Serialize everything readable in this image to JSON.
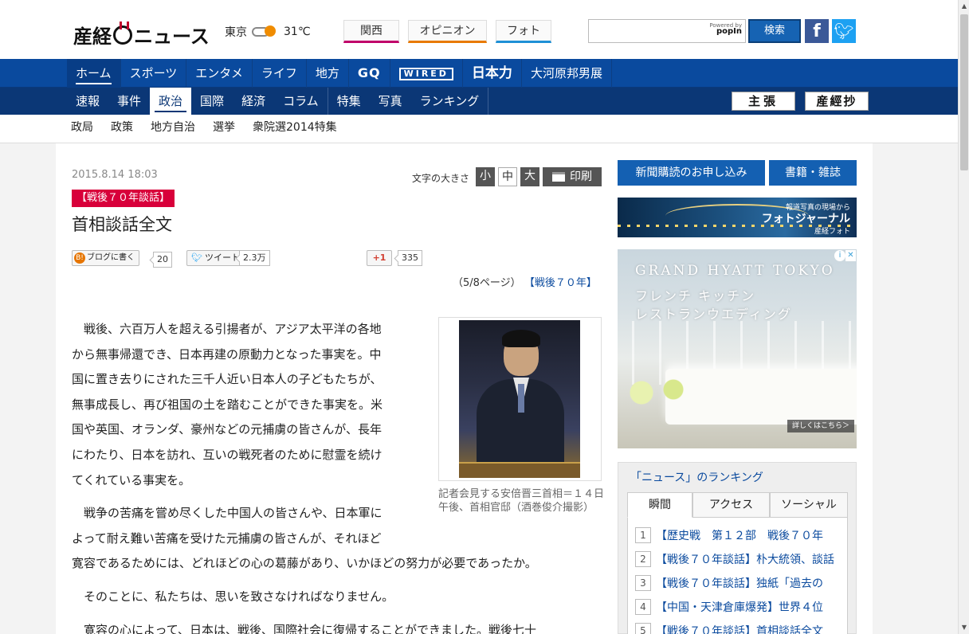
{
  "header": {
    "logo_left": "産経",
    "logo_right": "ニュース",
    "weather_city": "東京",
    "weather_icon": "sun-cloud-icon",
    "weather_temp": "31℃",
    "tabs": [
      "関西",
      "オピニオン",
      "フォト"
    ],
    "search_placeholder": "",
    "powered_by_small": "Powered by",
    "powered_by_brand": "popIn",
    "search_button": "検索",
    "facebook": "f",
    "twitter": "t"
  },
  "nav_main": [
    "ホーム",
    "スポーツ",
    "エンタメ",
    "ライフ",
    "地方",
    "GQ",
    "WIRED",
    "日本力",
    "大河原邦男展"
  ],
  "nav_sections": [
    "速報",
    "事件",
    "政治",
    "国際",
    "経済",
    "コラム",
    "特集",
    "写真",
    "ランキング"
  ],
  "nav_badges": {
    "shucho": "主張",
    "sankeisho": "産經抄"
  },
  "subnav": [
    "政局",
    "政策",
    "地方自治",
    "選挙",
    "衆院選2014特集"
  ],
  "article": {
    "date": "2015.8.14 18:03",
    "fontsize_label": "文字の大きさ",
    "fontsize_small": "小",
    "fontsize_mid": "中",
    "fontsize_large": "大",
    "print": "印刷",
    "tag": "【戦後７０年談話】",
    "title": "首相談話全文",
    "share": {
      "hatena_label": "ブログに書く",
      "hatena_count": "20",
      "tweet_label": "ツイート",
      "tweet_count": "2.3万",
      "gplus_label": "+1",
      "gplus_count": "335"
    },
    "page_indicator": "（5/8ページ）",
    "page_indicator_link": "【戦後７０年】",
    "photo_caption": "記者会見する安倍晋三首相＝１４日午後、首相官邸（酒巻俊介撮影）",
    "paragraphs": [
      [
        "　戦後、六百万人を超える引揚者が、アジア太平洋の各地",
        "から無事帰還でき、日本再建の原動力となった事実を。中",
        "国に置き去りにされた三千人近い日本人の子どもたちが、",
        "無事成長し、再び祖国の土を踏むことができた事実を。米",
        "国や英国、オランダ、豪州などの元捕虜の皆さんが、長年",
        "にわたり、日本を訪れ、互いの戦死者のために慰霊を続け",
        "てくれている事実を。"
      ],
      [
        "　戦争の苦痛を嘗め尽くした中国人の皆さんや、日本軍に",
        "よって耐え難い苦痛を受けた元捕虜の皆さんが、それほど",
        "寛容であるためには、どれほどの心の葛藤があり、いかほどの努力が必要であったか。"
      ],
      [
        "　そのことに、私たちは、思いを致さなければなりません。"
      ],
      [
        "　寛容の心によって、日本は、戦後、国際社会に復帰することができました。戦後七十"
      ]
    ]
  },
  "sidebar": {
    "subscribe": "新聞購読のお申し込み",
    "books": "書籍・雑誌",
    "photojournal_small": "報道写真の現場から",
    "photojournal_main": "フォトジャーナル",
    "photojournal_brand": "産経フォト",
    "ad_title": "GRAND HYATT TOKYO",
    "ad_line1": "フレンチ キッチン",
    "ad_line2": "レストランウエディング",
    "ad_more": "詳しくはこちら＞",
    "ranking_title": "「ニュース」のランキング",
    "ranking_tabs": [
      "瞬間",
      "アクセス",
      "ソーシャル"
    ],
    "ranking_items": [
      {
        "num": "1",
        "text": "【歴史戦　第１２部　戦後７０年"
      },
      {
        "num": "2",
        "text": "【戦後７０年談話】朴大統領、談話"
      },
      {
        "num": "3",
        "text": "【戦後７０年談話】独紙「過去の"
      },
      {
        "num": "4",
        "text": "【中国・天津倉庫爆発】世界４位"
      },
      {
        "num": "5",
        "text": "【戦後７０年談話】首相談話全文"
      }
    ]
  },
  "colors": {
    "nav_main": "#0a4a9e",
    "nav_sections": "#0b3776",
    "tag": "#d8003a",
    "button_blue": "#1460b2"
  }
}
